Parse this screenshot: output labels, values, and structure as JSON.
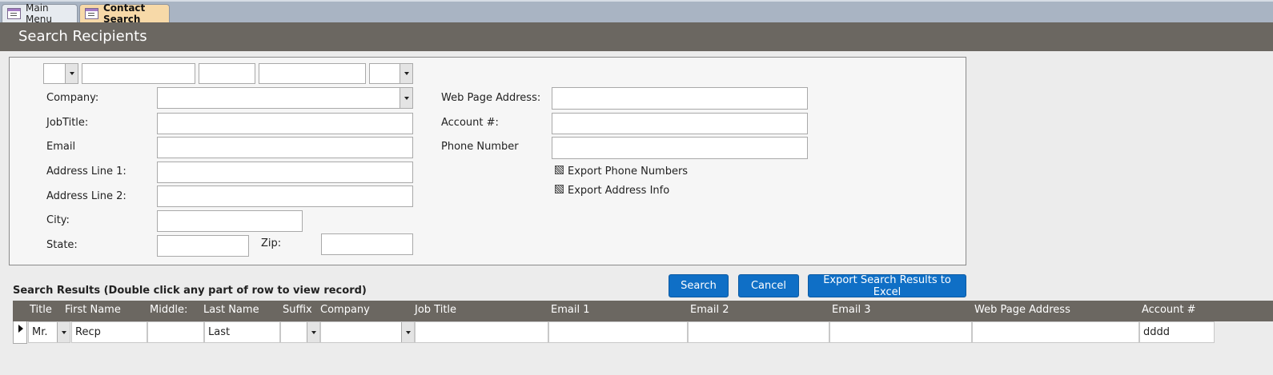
{
  "tabs": [
    {
      "label": "Main Menu",
      "icon": "form-icon"
    },
    {
      "label": "Contact Search",
      "icon": "form-icon"
    }
  ],
  "header": {
    "title": "Search Recipients"
  },
  "form": {
    "company_label": "Company:",
    "jobtitle_label": "JobTitle:",
    "email_label": "Email",
    "address1_label": "Address Line 1:",
    "address2_label": "Address Line 2:",
    "city_label": "City:",
    "state_label": "State:",
    "zip_label": "Zip:",
    "webpage_label": "Web Page Address:",
    "account_label": "Account #:",
    "phone_label": "Phone Number",
    "export_phone_label": "Export Phone Numbers",
    "export_address_label": "Export Address Info"
  },
  "buttons": {
    "search": "Search",
    "cancel": "Cancel",
    "export": "Export Search Results to Excel"
  },
  "results": {
    "title": "Search Results (Double click any part of row to view record)",
    "columns": [
      "Title",
      "First Name",
      "Middle:",
      "Last Name",
      "Suffix",
      "Company",
      "Job Title",
      "Email 1",
      "Email 2",
      "Email 3",
      "Web Page Address",
      "Account #"
    ],
    "row": {
      "title": "Mr.",
      "first_name": "Recp",
      "middle": "",
      "last_name": "Last",
      "suffix": "",
      "company": "",
      "job_title": "",
      "email1": "",
      "email2": "",
      "email3": "",
      "web_page": "",
      "account": "dddd"
    }
  },
  "colors": {
    "header_bg": "#6b6761",
    "button_bg": "#0f6fc6",
    "active_tab": "#f7d9a8",
    "tabstrip": "#a9b4c3"
  }
}
